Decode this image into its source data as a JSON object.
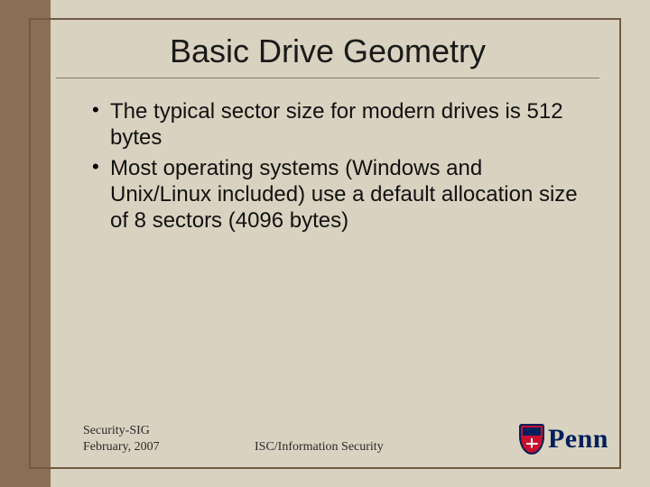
{
  "title": "Basic Drive Geometry",
  "bullets": [
    "The typical sector size for modern drives is 512 bytes",
    "Most operating systems (Windows and Unix/Linux included) use a default allocation size of 8 sectors (4096 bytes)"
  ],
  "footer": {
    "left_line1": "Security-SIG",
    "left_line2": "February, 2007",
    "center": "ISC/Information Security",
    "logo_text": "Penn"
  }
}
